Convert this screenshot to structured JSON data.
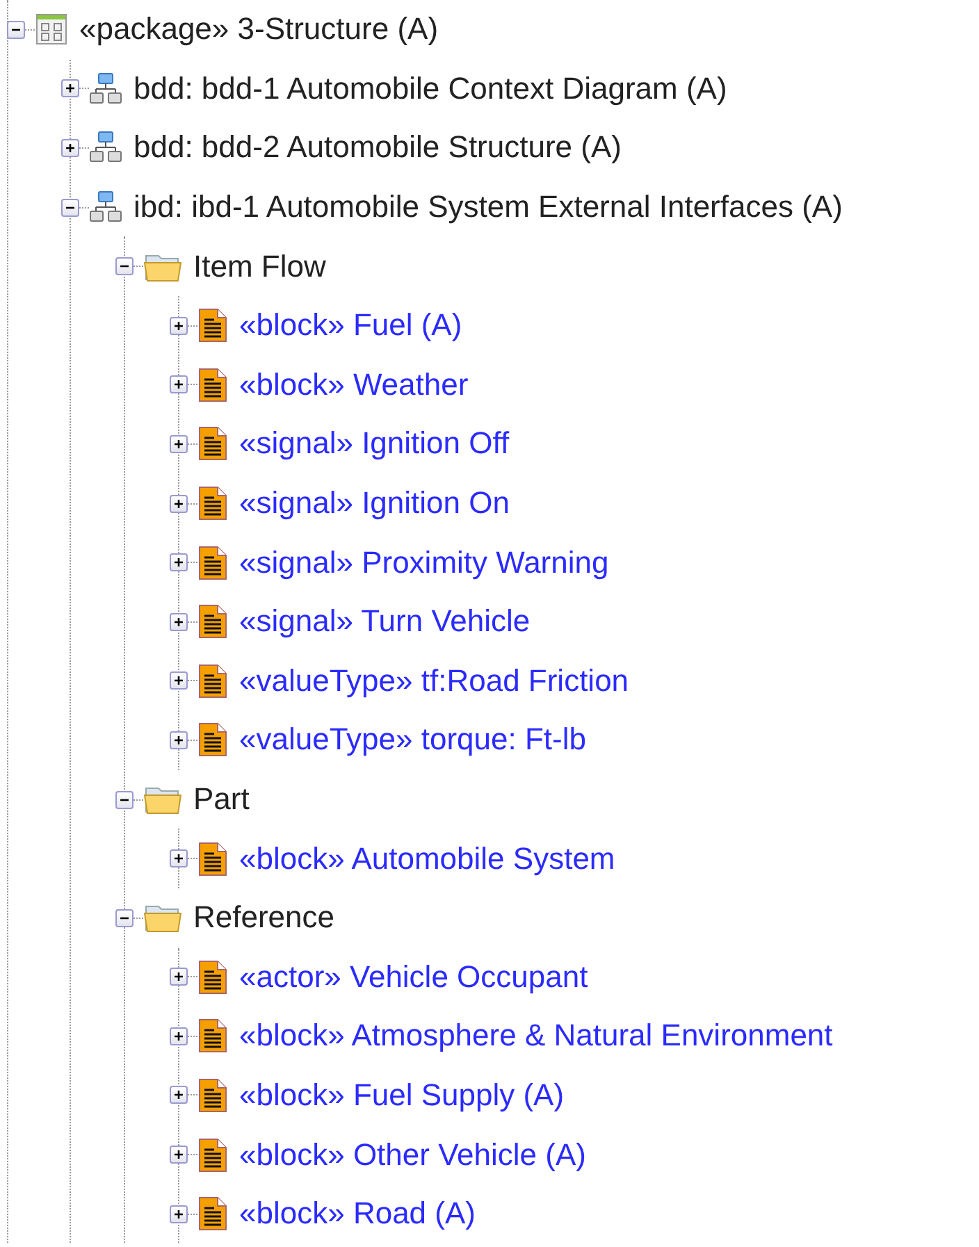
{
  "tree": [
    {
      "kind": "package",
      "label": "«package» 3-Structure (A)",
      "expanded": true,
      "children": [
        {
          "kind": "diagram",
          "label": "bdd: bdd-1 Automobile Context Diagram (A)",
          "expanded": false
        },
        {
          "kind": "diagram",
          "label": "bdd: bdd-2 Automobile Structure (A)",
          "expanded": false
        },
        {
          "kind": "diagram",
          "label": "ibd: ibd-1 Automobile System External Interfaces (A)",
          "expanded": true,
          "children": [
            {
              "kind": "folder",
              "label": "Item Flow",
              "expanded": true,
              "children": [
                {
                  "kind": "element",
                  "label": "«block» Fuel (A)",
                  "expanded": false
                },
                {
                  "kind": "element",
                  "label": "«block» Weather",
                  "expanded": false
                },
                {
                  "kind": "element",
                  "label": "«signal» Ignition Off",
                  "expanded": false
                },
                {
                  "kind": "element",
                  "label": "«signal» Ignition On",
                  "expanded": false
                },
                {
                  "kind": "element",
                  "label": "«signal» Proximity Warning",
                  "expanded": false
                },
                {
                  "kind": "element",
                  "label": "«signal» Turn Vehicle",
                  "expanded": false
                },
                {
                  "kind": "element",
                  "label": "«valueType» tf:Road Friction",
                  "expanded": false
                },
                {
                  "kind": "element",
                  "label": "«valueType» torque: Ft-lb",
                  "expanded": false
                }
              ]
            },
            {
              "kind": "folder",
              "label": "Part",
              "expanded": true,
              "children": [
                {
                  "kind": "element",
                  "label": "«block» Automobile System",
                  "expanded": false
                }
              ]
            },
            {
              "kind": "folder",
              "label": "Reference",
              "expanded": true,
              "children": [
                {
                  "kind": "element",
                  "label": "«actor» Vehicle Occupant",
                  "expanded": false
                },
                {
                  "kind": "element",
                  "label": "«block» Atmosphere & Natural Environment",
                  "expanded": false
                },
                {
                  "kind": "element",
                  "label": "«block» Fuel Supply (A)",
                  "expanded": false
                },
                {
                  "kind": "element",
                  "label": "«block» Other Vehicle (A)",
                  "expanded": false
                },
                {
                  "kind": "element",
                  "label": "«block» Road (A)",
                  "expanded": false
                }
              ]
            }
          ]
        }
      ]
    }
  ]
}
